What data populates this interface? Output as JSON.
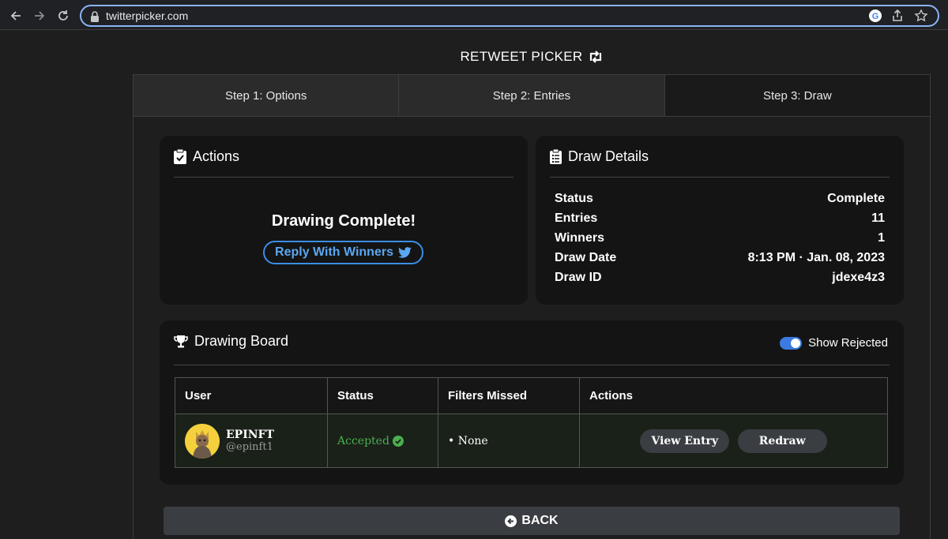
{
  "browser": {
    "url": "twitterpicker.com"
  },
  "page": {
    "title": "RETWEET PICKER"
  },
  "steps": [
    {
      "label": "Step 1: Options"
    },
    {
      "label": "Step 2: Entries"
    },
    {
      "label": "Step 3: Draw"
    }
  ],
  "actions_card": {
    "title": "Actions",
    "status_heading": "Drawing Complete!",
    "reply_button": "Reply With Winners"
  },
  "details_card": {
    "title": "Draw Details",
    "rows": [
      {
        "label": "Status",
        "value": "Complete"
      },
      {
        "label": "Entries",
        "value": "11"
      },
      {
        "label": "Winners",
        "value": "1"
      },
      {
        "label": "Draw Date",
        "value": "8:13 PM · Jan. 08, 2023"
      },
      {
        "label": "Draw ID",
        "value": "jdexe4z3"
      }
    ]
  },
  "board": {
    "title": "Drawing Board",
    "toggle_label": "Show Rejected",
    "toggle_on": true,
    "columns": [
      "User",
      "Status",
      "Filters Missed",
      "Actions"
    ],
    "rows": [
      {
        "name": "EPINFT",
        "handle": "@epinft1",
        "status": "Accepted",
        "filters_missed": "• None",
        "view_label": "View Entry",
        "redraw_label": "Redraw"
      }
    ]
  },
  "back_button": "BACK",
  "colors": {
    "accent_blue": "#3b8ee6",
    "accepted_green": "#4caf50",
    "background": "#1e1e1e",
    "card": "#141414"
  }
}
